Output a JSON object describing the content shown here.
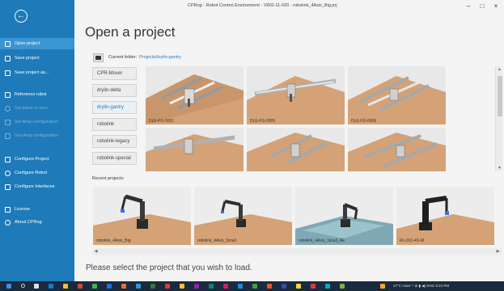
{
  "window": {
    "title": "CPRog - Robot Control Environment - V902-11-020 - robolink_4Axis_Big.prj",
    "minimize": "–",
    "maximize": "□",
    "close": "×"
  },
  "sidebar": {
    "back_icon": "arrow-left-circle-icon",
    "items": [
      {
        "label": "Open project",
        "state": "active"
      },
      {
        "label": "Save project",
        "state": "normal"
      },
      {
        "label": "Save project as...",
        "state": "normal"
      },
      {
        "label": "Reference robot",
        "state": "normal"
      },
      {
        "label": "Set joints to zero",
        "state": "disabled"
      },
      {
        "label": "Set Amp configuration",
        "state": "disabled"
      },
      {
        "label": "Get Amp configuration",
        "state": "disabled"
      },
      {
        "label": "Configure Project",
        "state": "normal"
      },
      {
        "label": "Configure Robot",
        "state": "normal"
      },
      {
        "label": "Configure Interfaces",
        "state": "normal"
      },
      {
        "label": "License",
        "state": "normal"
      },
      {
        "label": "About CPRog",
        "state": "normal"
      }
    ]
  },
  "main": {
    "page_title": "Open a project",
    "folder_label": "Current folder:",
    "folder_path": "Projects/drylin-gantry",
    "categories": [
      {
        "label": "CPR-Mover",
        "active": false
      },
      {
        "label": "drylin-delta",
        "active": false
      },
      {
        "label": "drylin-gantry",
        "active": true
      },
      {
        "label": "robolink",
        "active": false
      },
      {
        "label": "robolink-legacy",
        "active": false
      },
      {
        "label": "robolink-special",
        "active": false
      }
    ],
    "gallery": [
      {
        "label": "DLE-FG-0001"
      },
      {
        "label": "DLE-FG-0005"
      },
      {
        "label": "DLE-FG-0006"
      },
      {
        "label": ""
      },
      {
        "label": ""
      },
      {
        "label": ""
      }
    ],
    "recent_label": "Recent projects:",
    "recent": [
      {
        "label": "robolink_4Axis_Big"
      },
      {
        "label": "robolink_4Axis_Small"
      },
      {
        "label": "robolink_4Axis_Small_AE"
      },
      {
        "label": "RL-DCi-4S-M"
      }
    ],
    "status": "Please select the project that you wish to load."
  },
  "taskbar": {
    "tray": "27°C Haze  ^  ⊕  ▮  ◀)  ENG  9:23 PM"
  },
  "colors": {
    "sidebar": "#1e7ab8",
    "sidebar_active": "#3b95d1",
    "floor": "#d4a276",
    "taskbar": "#1a2a3f"
  }
}
